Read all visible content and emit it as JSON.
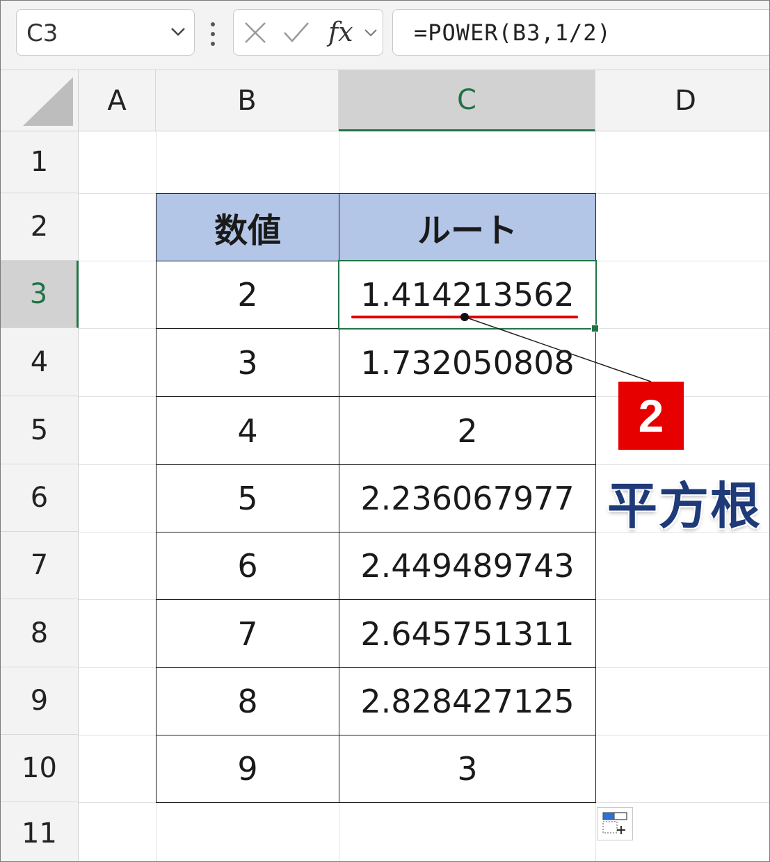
{
  "formula_bar": {
    "name_box": "C3",
    "fx_label": "fx",
    "formula": "=POWER(B3,1/2)"
  },
  "columns": [
    "A",
    "B",
    "C",
    "D"
  ],
  "rows": [
    "1",
    "2",
    "3",
    "4",
    "5",
    "6",
    "7",
    "8",
    "9",
    "10",
    "11"
  ],
  "table": {
    "headers": [
      "数値",
      "ルート"
    ],
    "rows": [
      [
        "2",
        "1.414213562"
      ],
      [
        "3",
        "1.732050808"
      ],
      [
        "4",
        "2"
      ],
      [
        "5",
        "2.236067977"
      ],
      [
        "6",
        "2.449489743"
      ],
      [
        "7",
        "2.645751311"
      ],
      [
        "8",
        "2.828427125"
      ],
      [
        "9",
        "3"
      ]
    ]
  },
  "selection": {
    "column": "C",
    "row": "3"
  },
  "annotation": {
    "number": "2",
    "label": "平方根",
    "badge_color": "#e60000",
    "label_color": "#1f3a78",
    "underline_color": "#e00000"
  },
  "colors": {
    "accent": "#217346",
    "header_fill": "#b4c6e7"
  }
}
